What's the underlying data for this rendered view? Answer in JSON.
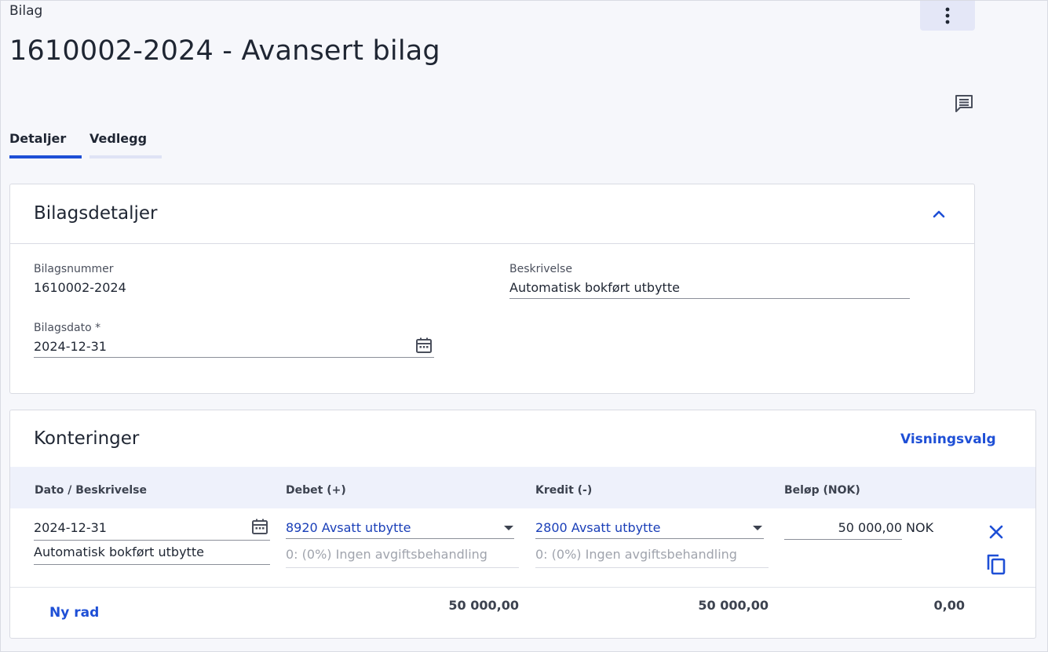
{
  "breadcrumb": "Bilag",
  "page_title": "1610002-2024 - Avansert bilag",
  "tabs": [
    {
      "label": "Detaljer",
      "active": true
    },
    {
      "label": "Vedlegg",
      "active": false
    }
  ],
  "details": {
    "title": "Bilagsdetaljer",
    "bilagsnummer_label": "Bilagsnummer",
    "bilagsnummer_value": "1610002-2024",
    "beskrivelse_label": "Beskrivelse",
    "beskrivelse_value": "Automatisk bokført utbytte",
    "bilagsdato_label": "Bilagsdato *",
    "bilagsdato_value": "2024-12-31"
  },
  "konteringer": {
    "title": "Konteringer",
    "view_options": "Visningsvalg",
    "columns": [
      "Dato / Beskrivelse",
      "Debet (+)",
      "Kredit (-)",
      "Beløp (NOK)"
    ],
    "row": {
      "date": "2024-12-31",
      "description": "Automatisk bokført utbytte",
      "debet_account": "8920 Avsatt utbytte",
      "debet_vat": "0: (0%) Ingen avgiftsbehandling",
      "kredit_account": "2800 Avsatt utbytte",
      "kredit_vat": "0: (0%) Ingen avgiftsbehandling",
      "amount": "50 000,00",
      "currency": "NOK"
    },
    "new_row": "Ny rad",
    "sum_debet": "50 000,00",
    "sum_kredit": "50 000,00",
    "sum_diff": "0,00"
  },
  "colors": {
    "accent": "#1e4fd6",
    "link": "#1a3fb8"
  },
  "icons": [
    "more-vertical-icon",
    "comment-icon",
    "chevron-up-icon",
    "calendar-icon",
    "close-icon",
    "copy-icon"
  ]
}
